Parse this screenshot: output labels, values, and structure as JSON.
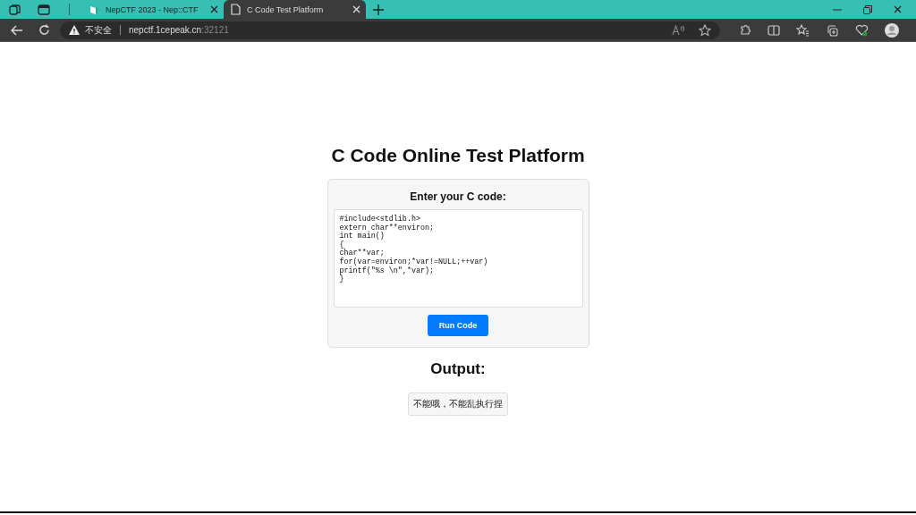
{
  "browser": {
    "tabs": [
      {
        "title": "NepCTF 2023 - Nep::CTF",
        "selected": false
      },
      {
        "title": "C Code Test Platform",
        "selected": true
      }
    ],
    "address_bar": {
      "security": "不安全",
      "host": "nepctf.1cepeak.cn",
      "port": ":32121"
    }
  },
  "page": {
    "title": "C Code Online Test Platform",
    "form_label": "Enter your C code:",
    "code": "#include<stdlib.h>\nextern char**environ;\nint main()\n{\nchar**var;\nfor(var=environ;*var!=NULL;++var)\nprintf(\"%s \\n\",*var);\n}",
    "button": "Run Code",
    "output_heading": "Output:",
    "output": "不能哦，不能乱执行捏"
  }
}
